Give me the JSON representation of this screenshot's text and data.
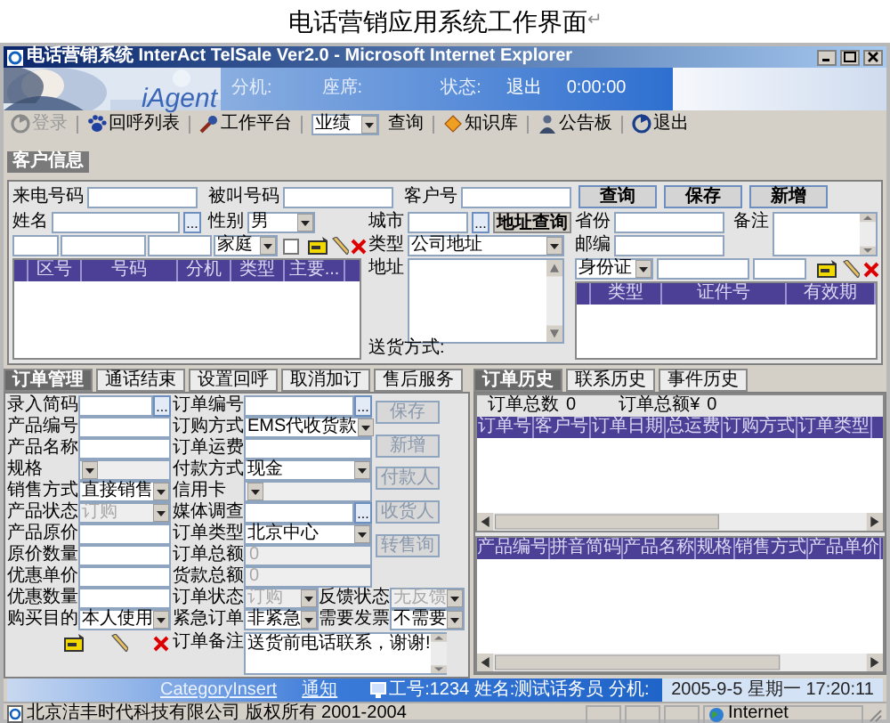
{
  "caption": {
    "text": "电话营销应用系统工作界面",
    "mark": "↵"
  },
  "window": {
    "title": "电话营销系统 InterAct TelSale Ver2.0 - Microsoft Internet Explorer"
  },
  "banner": {
    "logo": "iAgent",
    "extension_label": "分机:",
    "seat_label": "座席:",
    "status_label": "状态:",
    "status_value": "退出",
    "timer": "0:00:00"
  },
  "toolbar": [
    {
      "kind": "button",
      "label": "登录",
      "disabled": true
    },
    {
      "kind": "button",
      "label": "回呼列表",
      "disabled": false
    },
    {
      "kind": "button",
      "label": "工作平台",
      "disabled": false
    },
    {
      "kind": "select",
      "value": "业绩"
    },
    {
      "kind": "button",
      "label": "查询",
      "disabled": false
    },
    {
      "kind": "button",
      "label": "知识库",
      "disabled": false
    },
    {
      "kind": "button",
      "label": "公告板",
      "disabled": false
    },
    {
      "kind": "button",
      "label": "退出",
      "disabled": false
    }
  ],
  "customer": {
    "title": "客户信息",
    "caller_label": "来电号码",
    "called_label": "被叫号码",
    "customer_no_label": "客户号",
    "buttons": [
      "查询",
      "保存",
      "新增"
    ],
    "name_label": "姓名",
    "name_button": "...",
    "gender_label": "性别",
    "gender": "男",
    "phone_type": "家庭",
    "phone_checkbox": {
      "checked": false
    },
    "phone_columns": [
      "区号",
      "号码",
      "分机",
      "类型",
      "主要..."
    ],
    "city_label": "城市",
    "city_button": "...",
    "address_lookup": "地址查询",
    "type_label": "类型",
    "address_type": "公司地址",
    "address_label": "地址",
    "delivery_label": "送货方式:",
    "province_label": "省份",
    "remark_label": "备注",
    "zip_label": "邮编",
    "id_type": "身份证",
    "id_columns": [
      "类型",
      "证件号",
      "有效期"
    ]
  },
  "order": {
    "tabs": [
      {
        "label": "订单管理",
        "selected": true
      },
      {
        "label": "通话结束",
        "selected": false
      },
      {
        "label": "设置回呼",
        "selected": false
      },
      {
        "label": "取消加订",
        "selected": false
      },
      {
        "label": "售后服务",
        "selected": false
      }
    ],
    "fields": [
      {
        "label": "录入简码",
        "kind": "lookup",
        "button": "...",
        "disabled": false
      },
      {
        "label": "产品编号",
        "kind": "text",
        "disabled": false
      },
      {
        "label": "产品名称",
        "kind": "text",
        "disabled": false
      },
      {
        "label": "规格",
        "kind": "select",
        "disabled": true
      },
      {
        "label": "销售方式",
        "kind": "select",
        "value": "直接销售",
        "disabled": false
      },
      {
        "label": "产品状态",
        "kind": "select",
        "value": "订购",
        "disabled": true
      },
      {
        "label": "产品原价",
        "kind": "text",
        "disabled": false
      },
      {
        "label": "原价数量",
        "kind": "text",
        "disabled": false
      },
      {
        "label": "优惠单价",
        "kind": "text",
        "disabled": false
      },
      {
        "label": "优惠数量",
        "kind": "text",
        "disabled": false
      },
      {
        "label": "购买目的",
        "kind": "select",
        "value": "本人使用",
        "disabled": false
      }
    ],
    "details": [
      {
        "label": "订单编号",
        "kind": "lookup",
        "button": "...",
        "disabled": false
      },
      {
        "label": "订购方式",
        "kind": "select",
        "value": "EMS代收货款",
        "disabled": false
      },
      {
        "label": "订单运费",
        "kind": "text",
        "disabled": false
      },
      {
        "label": "付款方式",
        "kind": "select",
        "value": "现金",
        "disabled": false
      },
      {
        "label": "信用卡",
        "kind": "select",
        "disabled": true
      },
      {
        "label": "媒体调查",
        "kind": "lookup",
        "button": "...",
        "disabled": false
      },
      {
        "label": "订单类型",
        "kind": "select",
        "value": "北京中心",
        "disabled": false
      },
      {
        "label": "订单总额",
        "kind": "text",
        "value": "0",
        "disabled": true
      },
      {
        "label": "货款总额",
        "kind": "text",
        "value": "0",
        "disabled": true
      }
    ],
    "status_rows": [
      {
        "label": "订单状态",
        "value": "订购",
        "disabled": true,
        "second_label": "反馈状态",
        "second_value": "无反馈",
        "second_disabled": true
      },
      {
        "label": "紧急订单",
        "value": "非紧急",
        "disabled": false,
        "second_label": "需要发票",
        "second_value": "不需要",
        "second_disabled": false
      }
    ],
    "note": {
      "label": "订单备注",
      "value": "送货前电话联系，谢谢!"
    },
    "buttons": [
      {
        "label": "保存",
        "disabled": true
      },
      {
        "label": "新增",
        "disabled": true
      },
      {
        "label": "付款人",
        "disabled": true
      },
      {
        "label": "收货人",
        "disabled": true
      },
      {
        "label": "转售询",
        "disabled": true
      }
    ]
  },
  "history": {
    "tabs": [
      {
        "label": "订单历史",
        "selected": true
      },
      {
        "label": "联系历史",
        "selected": false
      },
      {
        "label": "事件历史",
        "selected": false
      }
    ],
    "count_label": "订单总数",
    "count": "0",
    "total_label": "订单总额¥",
    "total": "0",
    "order_columns": [
      "订单号",
      "客户号",
      "订单日期",
      "总运费",
      "订购方式",
      "订单类型"
    ],
    "product_columns": [
      "产品编号",
      "拼音简码",
      "产品名称",
      "规格",
      "销售方式",
      "产品单价"
    ]
  },
  "status": {
    "links": [
      "CategoryInsert",
      "通知"
    ],
    "agent": "工号:1234 姓名:测试话务员 分机:",
    "datetime": "2005-9-5 星期一 17:20:11"
  },
  "ie_status": {
    "text": "北京洁丰时代科技有限公司 版权所有 2001-2004",
    "zone": "Internet"
  }
}
